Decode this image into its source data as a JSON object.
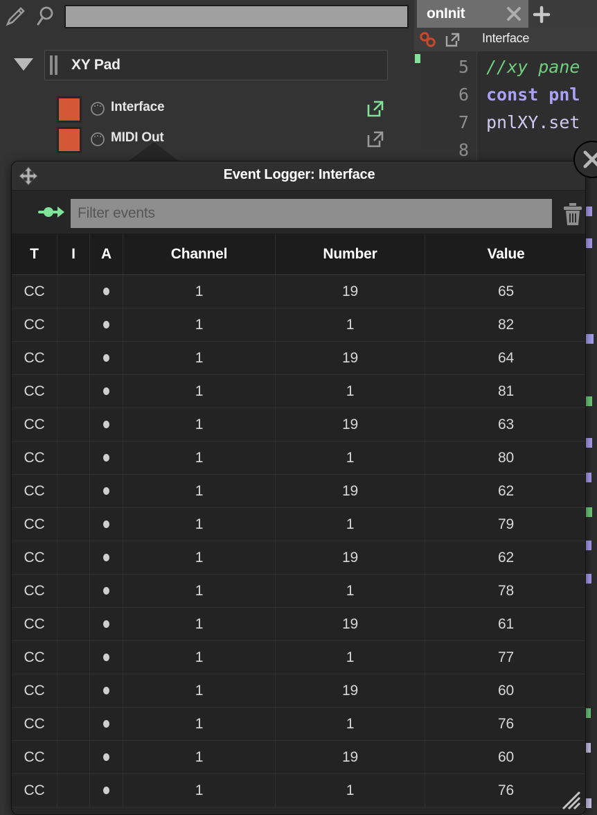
{
  "toolbar": {
    "pencil_icon": "pencil-icon",
    "search_icon": "search-icon",
    "search_value": "",
    "search_placeholder": ""
  },
  "tree": {
    "group": {
      "label": "XY Pad",
      "expanded": true
    },
    "items": [
      {
        "label": "Interface",
        "swatch_color": "#d45737",
        "link_color": "#7fe39a",
        "link_active": true
      },
      {
        "label": "MIDI Out",
        "swatch_color": "#d45737",
        "link_color": "#9a9a9a",
        "link_active": false
      }
    ]
  },
  "editor": {
    "tab": {
      "label": "onInit",
      "close_icon": "close-icon",
      "add_icon": "plus-icon"
    },
    "scope_label": "Interface",
    "link_icon": "chain-link-icon",
    "external_icon": "external-link-icon",
    "lines": [
      {
        "number": "5",
        "text": "//xy pane",
        "kind": "comment"
      },
      {
        "number": "6",
        "text": "const pnl",
        "kind": "keyword"
      },
      {
        "number": "7",
        "text": "pnlXY.set",
        "kind": "plain"
      },
      {
        "number": "8",
        "text": "",
        "kind": "plain"
      }
    ],
    "close_button_icon": "close-circle-icon"
  },
  "logger": {
    "title": "Event Logger: Interface",
    "move_handle_icon": "move-icon",
    "pass_arrow_icon": "signal-arrow-icon",
    "clear_icon": "trash-icon",
    "filter": {
      "value": "",
      "placeholder": "Filter events"
    },
    "resize_grip_icon": "resize-grip-icon",
    "columns": [
      "T",
      "I",
      "A",
      "Channel",
      "Number",
      "Value"
    ],
    "rows": [
      {
        "t": "CC",
        "i": "",
        "a": "●",
        "channel": "1",
        "number": "19",
        "value": "65"
      },
      {
        "t": "CC",
        "i": "",
        "a": "●",
        "channel": "1",
        "number": "1",
        "value": "82"
      },
      {
        "t": "CC",
        "i": "",
        "a": "●",
        "channel": "1",
        "number": "19",
        "value": "64"
      },
      {
        "t": "CC",
        "i": "",
        "a": "●",
        "channel": "1",
        "number": "1",
        "value": "81"
      },
      {
        "t": "CC",
        "i": "",
        "a": "●",
        "channel": "1",
        "number": "19",
        "value": "63"
      },
      {
        "t": "CC",
        "i": "",
        "a": "●",
        "channel": "1",
        "number": "1",
        "value": "80"
      },
      {
        "t": "CC",
        "i": "",
        "a": "●",
        "channel": "1",
        "number": "19",
        "value": "62"
      },
      {
        "t": "CC",
        "i": "",
        "a": "●",
        "channel": "1",
        "number": "1",
        "value": "79"
      },
      {
        "t": "CC",
        "i": "",
        "a": "●",
        "channel": "1",
        "number": "19",
        "value": "62"
      },
      {
        "t": "CC",
        "i": "",
        "a": "●",
        "channel": "1",
        "number": "1",
        "value": "78"
      },
      {
        "t": "CC",
        "i": "",
        "a": "●",
        "channel": "1",
        "number": "19",
        "value": "61"
      },
      {
        "t": "CC",
        "i": "",
        "a": "●",
        "channel": "1",
        "number": "1",
        "value": "77"
      },
      {
        "t": "CC",
        "i": "",
        "a": "●",
        "channel": "1",
        "number": "19",
        "value": "60"
      },
      {
        "t": "CC",
        "i": "",
        "a": "●",
        "channel": "1",
        "number": "1",
        "value": "76"
      },
      {
        "t": "CC",
        "i": "",
        "a": "●",
        "channel": "1",
        "number": "19",
        "value": "60"
      },
      {
        "t": "CC",
        "i": "",
        "a": "●",
        "channel": "1",
        "number": "1",
        "value": "76"
      }
    ]
  },
  "colors": {
    "accent_orange": "#d45737",
    "accent_green": "#7fe39a",
    "panel_bg": "#262626",
    "app_bg": "#333333"
  }
}
